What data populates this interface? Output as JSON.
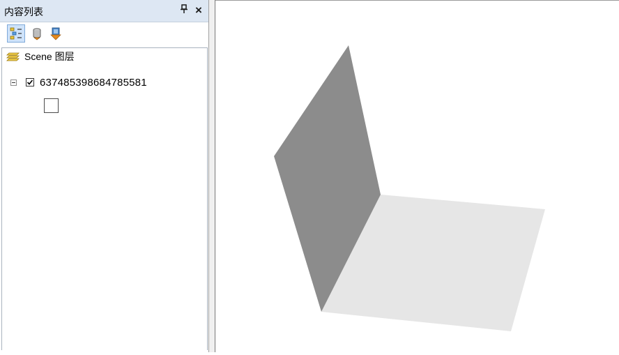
{
  "toc": {
    "title": "内容列表",
    "pin_glyph": "ᵖ",
    "close_glyph": "×",
    "toolbar": [
      {
        "name": "list-by-drawing-order-button",
        "icon": "layers-list-icon",
        "active": true
      },
      {
        "name": "list-by-source-button",
        "icon": "database-icon",
        "active": false
      },
      {
        "name": "list-by-visibility-button",
        "icon": "visibility-icon",
        "active": false
      }
    ],
    "tree": {
      "scene_label": "Scene 图层",
      "layer_label": "637485398684785581",
      "layer_checked": true
    }
  },
  "colors": {
    "header_bg": "#dde7f3",
    "vertical_plane": "#8c8c8c",
    "horizontal_plane": "#e6e6e6"
  }
}
